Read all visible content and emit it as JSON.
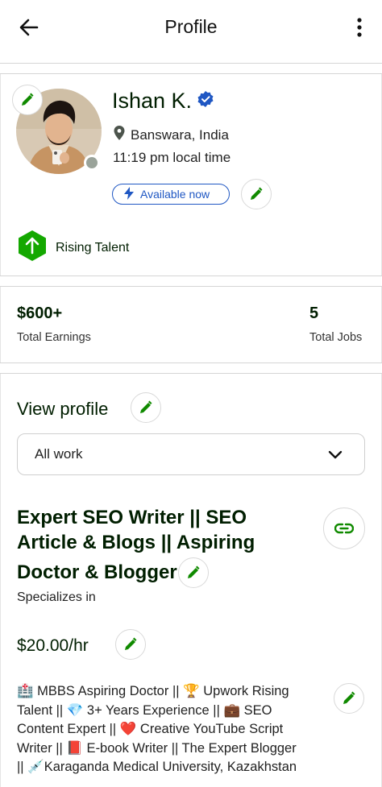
{
  "header": {
    "title": "Profile",
    "back_icon": "arrow-left-icon",
    "menu_icon": "more-vertical-icon"
  },
  "profile": {
    "name": "Ishan K.",
    "verified_icon": "verified-badge-icon",
    "location": "Banswara, India",
    "local_time": "11:19 pm local time",
    "availability": "Available now",
    "badge": "Rising Talent"
  },
  "stats": {
    "earnings_value": "$600+",
    "earnings_label": "Total Earnings",
    "jobs_value": "5",
    "jobs_label": "Total Jobs"
  },
  "profile_section": {
    "view_profile": "View profile",
    "dropdown_value": "All work"
  },
  "job": {
    "title_lines": [
      "Expert SEO Writer || SEO",
      "Article & Blogs || Aspiring",
      "Doctor & Blogger"
    ],
    "specializes": "Specializes in",
    "rate": "$20.00/hr",
    "overview_lines": [
      "🏥 MBBS Aspiring Doctor || 🏆 Upwork Rising",
      "Talent || 💎 3+ Years Experience || 💼 SEO",
      "Content Expert || ❤️ Creative YouTube Script",
      "Writer || 📕 E-book Writer || The Expert Blogger",
      "|| 💉Karaganda Medical University, Kazakhstan"
    ]
  },
  "colors": {
    "brand_green": "#14a800",
    "edit_green": "#108a00",
    "available_blue": "#1f57c3",
    "text": "#001e00"
  }
}
